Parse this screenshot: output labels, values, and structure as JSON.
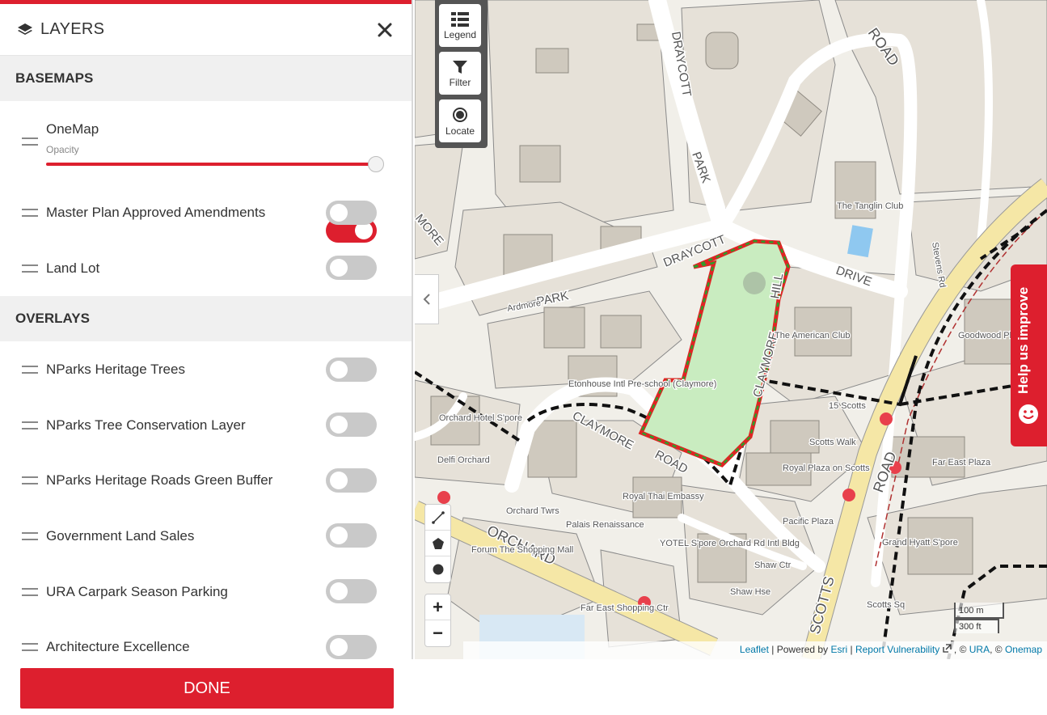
{
  "panel": {
    "title": "LAYERS",
    "close_icon": "close-icon",
    "sections": {
      "basemaps": "BASEMAPS",
      "overlays": "OVERLAYS"
    },
    "onemap": {
      "label": "OneMap",
      "opacity_label": "Opacity",
      "enabled": true,
      "opacity": 1.0
    },
    "basemap_layers": [
      {
        "label": "Master Plan Approved Amendments",
        "enabled": false
      },
      {
        "label": "Land Lot",
        "enabled": false
      }
    ],
    "overlay_layers": [
      {
        "label": "NParks Heritage Trees",
        "enabled": false
      },
      {
        "label": "NParks Tree Conservation Layer",
        "enabled": false
      },
      {
        "label": "NParks Heritage Roads Green Buffer",
        "enabled": false
      },
      {
        "label": "Government Land Sales",
        "enabled": false
      },
      {
        "label": "URA Carpark Season Parking",
        "enabled": false
      },
      {
        "label": "Architecture Excellence",
        "enabled": false
      }
    ],
    "done_label": "DONE"
  },
  "map": {
    "tools": {
      "legend": "Legend",
      "filter": "Filter",
      "locate": "Locate"
    },
    "zoom_in": "+",
    "zoom_out": "−",
    "help_tab": "Help us improve",
    "scale": {
      "metric": "100 m",
      "imperial": "300 ft"
    },
    "attribution": {
      "leaflet": "Leaflet",
      "powered_by": "| Powered by",
      "esri": "Esri",
      "sep1": "|",
      "report": "Report Vulnerability",
      "copy_ura": ", ©",
      "ura": "URA",
      "copy_onemap": ", ©",
      "onemap": "Onemap"
    },
    "labels": {
      "draycott_park": "DRAYCOTT",
      "park": "PARK",
      "road_top": "ROAD",
      "draycott_drive": "DRAYCOTT",
      "drive": "DRIVE",
      "park_left": "PARK",
      "claymore_road": "CLAYMORE",
      "road_mid": "ROAD",
      "claymore_hill": "CLAYMORE",
      "hill": "HILL",
      "orchard": "ORCHARD",
      "scotts": "SCOTTS",
      "road_scotts": "ROAD",
      "tanglin_club": "The Tanglin Club",
      "american_club": "The American Club",
      "etonhouse": "Etonhouse Intl Pre-school (Claymore)",
      "scotts_15": "15 Scotts",
      "scotts_walk": "Scotts Walk",
      "royal_plaza": "Royal Plaza on Scotts",
      "far_east_plaza": "Far East Plaza",
      "royal_thai": "Royal Thai Embassy",
      "pacific_plaza": "Pacific Plaza",
      "grand_hyatt": "Grand Hyatt S'pore",
      "yotel": "YOTEL S'pore Orchard Rd Intl Bldg",
      "shaw_ctr": "Shaw Ctr",
      "shaw_hse": "Shaw Hse",
      "palais": "Palais Renaissance",
      "orchard_twrs": "Orchard Twrs",
      "forum": "Forum The Shopping Mall",
      "far_east_shopping": "Far East Shopping Ctr",
      "scotts_sq": "Scotts Sq",
      "goodwood": "Goodwood Pk Hotel",
      "orchard_hotel": "Orchard Hotel S'pore",
      "delfi": "Delfi Orchard",
      "stevens_rd": "Stevens Rd",
      "ardmore": "Ardmore",
      "more": "MORE"
    }
  },
  "colors": {
    "accent": "#dd1f2e",
    "toggle_off": "#c9c9c9",
    "highlight_fill": "#c9ecc0",
    "highlight_stroke_red": "#e02424",
    "highlight_stroke_green": "#2aa02a",
    "main_road": "#f5e7a6"
  }
}
